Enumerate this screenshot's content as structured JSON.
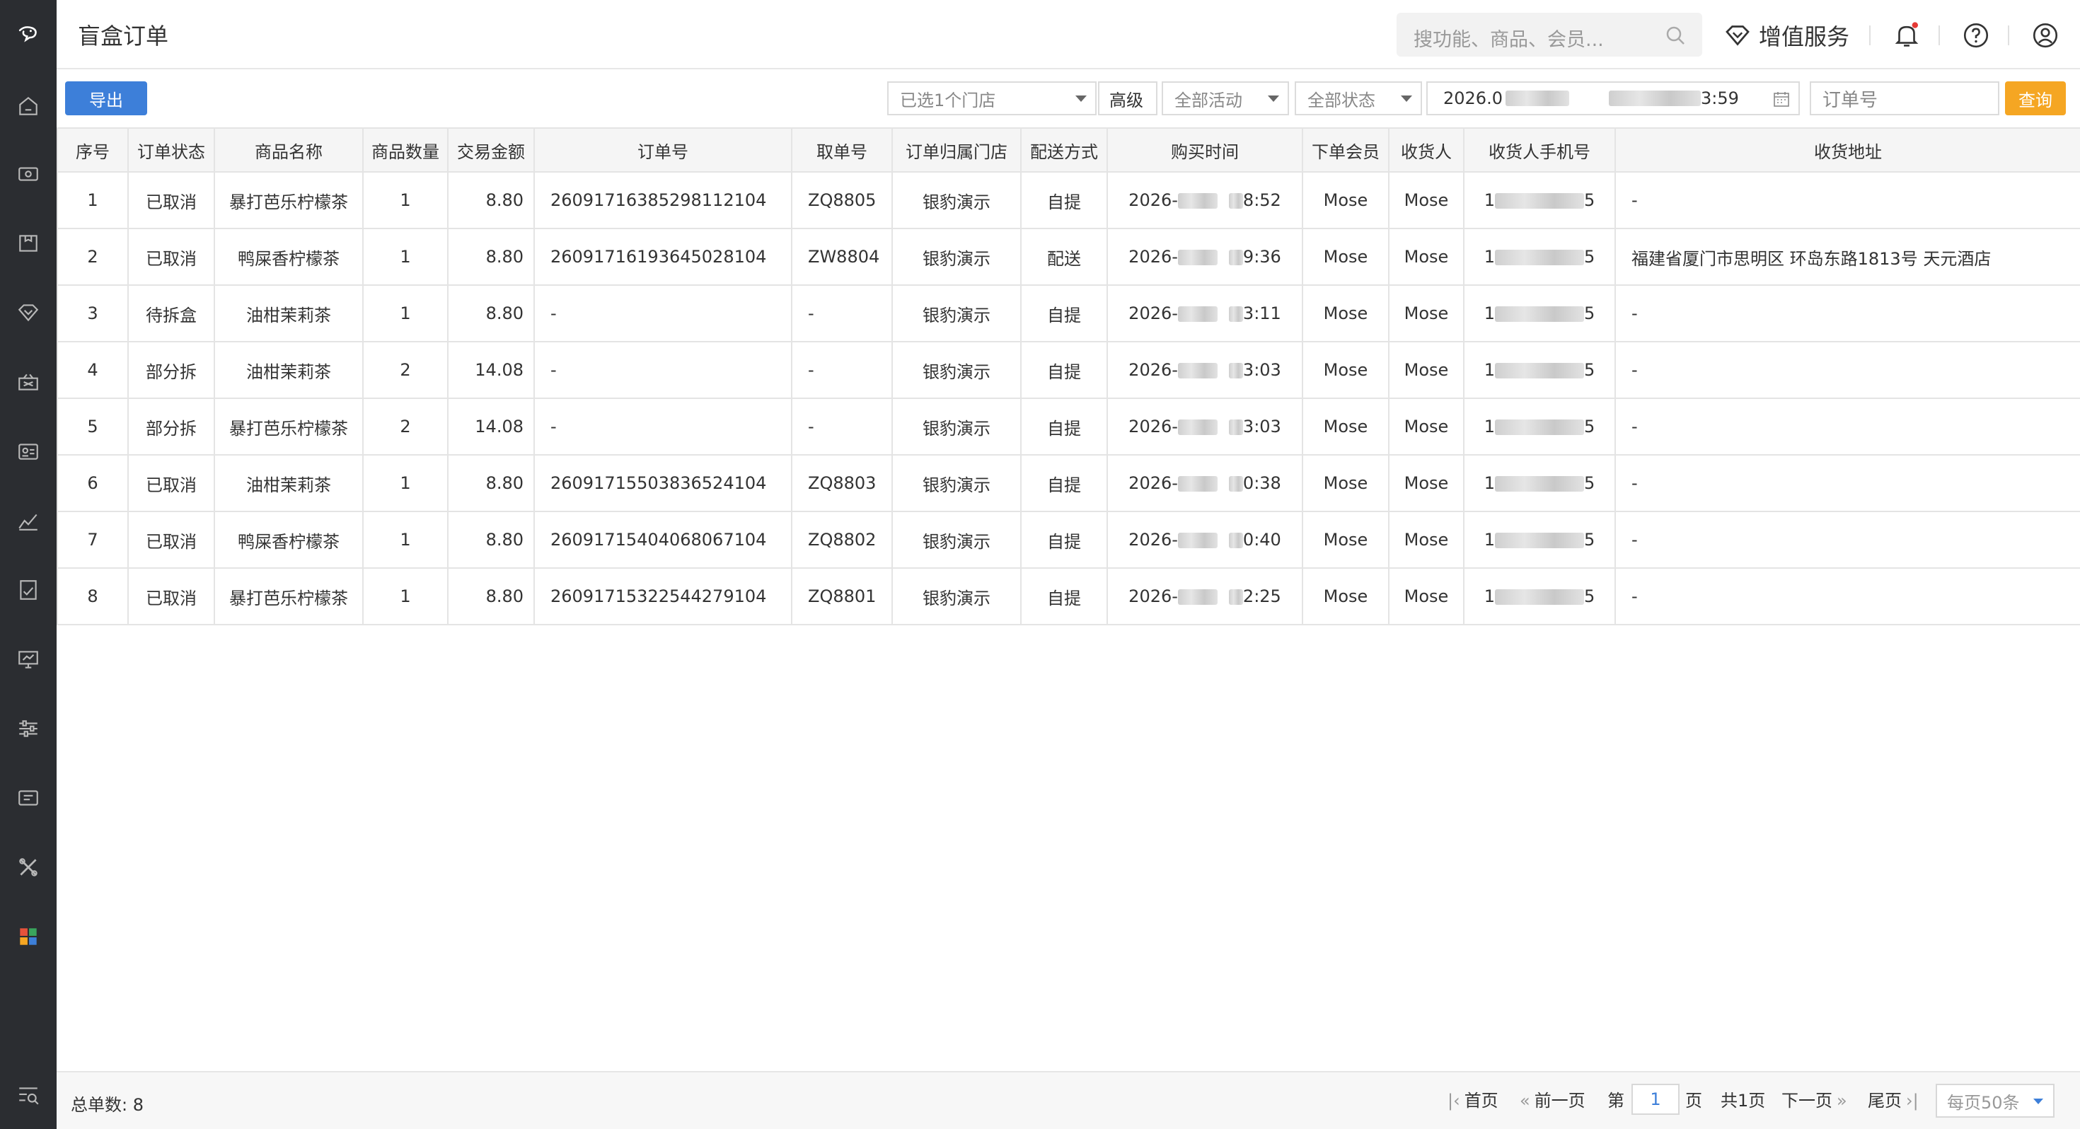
{
  "header": {
    "title": "盲盒订单",
    "search_placeholder": "搜功能、商品、会员...",
    "value_added_label": "增值服务"
  },
  "toolbar": {
    "export_label": "导出",
    "store_select": "已选1个门店",
    "advanced_label": "高级",
    "activity_select": "全部活动",
    "status_select": "全部状态",
    "date_start_prefix": "2026.0",
    "date_end_suffix": "3:59",
    "order_no_placeholder": "订单号",
    "query_label": "查询"
  },
  "table": {
    "headers": [
      "序号",
      "订单状态",
      "商品名称",
      "商品数量",
      "交易金额",
      "订单号",
      "取单号",
      "订单归属门店",
      "配送方式",
      "购买时间",
      "下单会员",
      "收货人",
      "收货人手机号",
      "收货地址"
    ],
    "rows": [
      {
        "no": "1",
        "status": "已取消",
        "product": "暴打芭乐柠檬茶",
        "qty": "1",
        "amount": "8.80",
        "order_no": "26091716385298112104",
        "pickup": "ZQ8805",
        "store": "银豹演示",
        "delivery": "自提",
        "time_prefix": "2026-",
        "time_suffix": "8:52",
        "member": "Mose",
        "receiver": "Mose",
        "phone_prefix": "1",
        "phone_suffix": "5",
        "address": "-"
      },
      {
        "no": "2",
        "status": "已取消",
        "product": "鸭屎香柠檬茶",
        "qty": "1",
        "amount": "8.80",
        "order_no": "26091716193645028104",
        "pickup": "ZW8804",
        "store": "银豹演示",
        "delivery": "配送",
        "time_prefix": "2026-",
        "time_suffix": "9:36",
        "member": "Mose",
        "receiver": "Mose",
        "phone_prefix": "1",
        "phone_suffix": "5",
        "address": "福建省厦门市思明区 环岛东路1813号 天元酒店"
      },
      {
        "no": "3",
        "status": "待拆盒",
        "product": "油柑茉莉茶",
        "qty": "1",
        "amount": "8.80",
        "order_no": "-",
        "pickup": "-",
        "store": "银豹演示",
        "delivery": "自提",
        "time_prefix": "2026-",
        "time_suffix": "3:11",
        "member": "Mose",
        "receiver": "Mose",
        "phone_prefix": "1",
        "phone_suffix": "5",
        "address": "-"
      },
      {
        "no": "4",
        "status": "部分拆",
        "product": "油柑茉莉茶",
        "qty": "2",
        "amount": "14.08",
        "order_no": "-",
        "pickup": "-",
        "store": "银豹演示",
        "delivery": "自提",
        "time_prefix": "2026-",
        "time_suffix": "3:03",
        "member": "Mose",
        "receiver": "Mose",
        "phone_prefix": "1",
        "phone_suffix": "5",
        "address": "-"
      },
      {
        "no": "5",
        "status": "部分拆",
        "product": "暴打芭乐柠檬茶",
        "qty": "2",
        "amount": "14.08",
        "order_no": "-",
        "pickup": "-",
        "store": "银豹演示",
        "delivery": "自提",
        "time_prefix": "2026-",
        "time_suffix": "3:03",
        "member": "Mose",
        "receiver": "Mose",
        "phone_prefix": "1",
        "phone_suffix": "5",
        "address": "-"
      },
      {
        "no": "6",
        "status": "已取消",
        "product": "油柑茉莉茶",
        "qty": "1",
        "amount": "8.80",
        "order_no": "26091715503836524104",
        "pickup": "ZQ8803",
        "store": "银豹演示",
        "delivery": "自提",
        "time_prefix": "2026-",
        "time_suffix": "0:38",
        "member": "Mose",
        "receiver": "Mose",
        "phone_prefix": "1",
        "phone_suffix": "5",
        "address": "-"
      },
      {
        "no": "7",
        "status": "已取消",
        "product": "鸭屎香柠檬茶",
        "qty": "1",
        "amount": "8.80",
        "order_no": "26091715404068067104",
        "pickup": "ZQ8802",
        "store": "银豹演示",
        "delivery": "自提",
        "time_prefix": "2026-",
        "time_suffix": "0:40",
        "member": "Mose",
        "receiver": "Mose",
        "phone_prefix": "1",
        "phone_suffix": "5",
        "address": "-"
      },
      {
        "no": "8",
        "status": "已取消",
        "product": "暴打芭乐柠檬茶",
        "qty": "1",
        "amount": "8.80",
        "order_no": "26091715322544279104",
        "pickup": "ZQ8801",
        "store": "银豹演示",
        "delivery": "自提",
        "time_prefix": "2026-",
        "time_suffix": "2:25",
        "member": "Mose",
        "receiver": "Mose",
        "phone_prefix": "1",
        "phone_suffix": "5",
        "address": "-"
      }
    ]
  },
  "footer": {
    "total_label": "总单数:",
    "total_value": "8",
    "first": "首页",
    "prev": "前一页",
    "page_prefix": "第",
    "page_value": "1",
    "page_suffix": "页",
    "total_pages": "共1页",
    "next": "下一页",
    "last": "尾页",
    "per_page": "每页50条"
  },
  "colors": {
    "sidebar_bg": "#2b2d31",
    "primary": "#3d7fd9",
    "query_button": "#f5a623",
    "notification_dot": "#e53935"
  },
  "icons": {
    "sidebar": [
      "logo-icon",
      "home-icon",
      "cashier-icon",
      "product-icon",
      "member-icon",
      "marketing-icon",
      "employee-icon",
      "report-icon",
      "finance-icon",
      "device-icon",
      "settings-icon",
      "ticket-icon",
      "tools-icon",
      "apps-icon",
      "search-menu-icon"
    ],
    "topbar": [
      "search-icon",
      "diamond-icon",
      "bell-icon",
      "help-icon",
      "user-icon"
    ]
  }
}
